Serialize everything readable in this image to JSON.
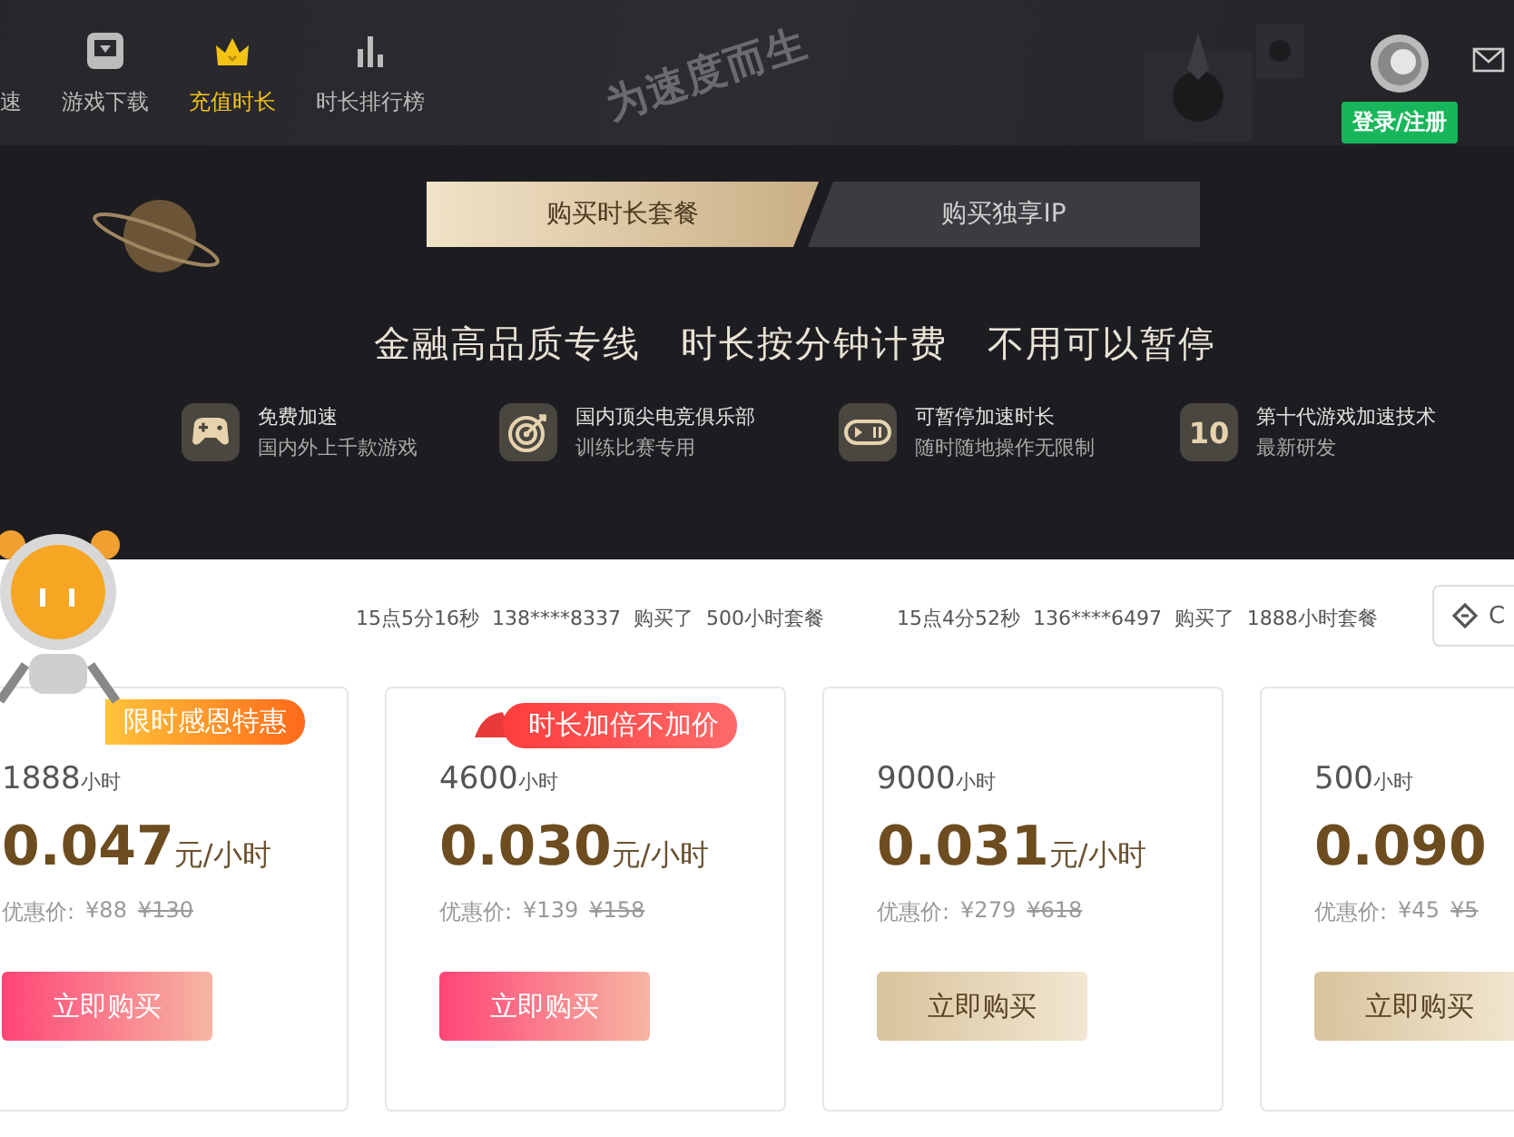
{
  "nav": {
    "items": [
      {
        "label": "速",
        "selected": false
      },
      {
        "label": "游戏下载",
        "kind": "download",
        "selected": false
      },
      {
        "label": "充值时长",
        "kind": "crown",
        "selected": true
      },
      {
        "label": "时长排行榜",
        "kind": "bars",
        "selected": false
      }
    ],
    "slogan": "为速度而生"
  },
  "user": {
    "login_button": "登录/注册"
  },
  "hero": {
    "tabs": [
      {
        "label": "购买时长套餐",
        "selected": true
      },
      {
        "label": "购买独享IP",
        "selected": false
      }
    ],
    "headline": "金融高品质专线   时长按分钟计费   不用可以暂停",
    "features": [
      {
        "kind": "gamepad",
        "title": "免费加速",
        "subtitle": "国内外上千款游戏"
      },
      {
        "kind": "target",
        "title": "国内顶尖电竞俱乐部",
        "subtitle": "训练比赛专用"
      },
      {
        "kind": "pause",
        "title": "可暂停加速时长",
        "subtitle": "随时随地操作无限制"
      },
      {
        "kind": "number",
        "icon_text": "10",
        "title": "第十代游戏加速技术",
        "subtitle": "最新研发"
      }
    ]
  },
  "ticker": [
    "15点5分16秒  138****8337  购买了  500小时套餐",
    "15点4分52秒  136****6497  购买了  1888小时套餐"
  ],
  "side_button": {
    "label": "C"
  },
  "plans": [
    {
      "hours": "1888",
      "hours_unit": "小时",
      "price": "0.047",
      "price_unit": "元/小时",
      "discount_label": "优惠价:",
      "discount_price": "¥88",
      "original_price": "¥130",
      "badge": {
        "kind": "sale",
        "text": "限时感恩特惠"
      },
      "button": {
        "kind": "promo",
        "label": "立即购买"
      }
    },
    {
      "hours": "4600",
      "hours_unit": "小时",
      "price": "0.030",
      "price_unit": "元/小时",
      "discount_label": "优惠价:",
      "discount_price": "¥139",
      "original_price": "¥158",
      "badge": {
        "kind": "holiday",
        "text": "时长加倍不加价"
      },
      "button": {
        "kind": "promo",
        "label": "立即购买"
      }
    },
    {
      "hours": "9000",
      "hours_unit": "小时",
      "price": "0.031",
      "price_unit": "元/小时",
      "discount_label": "优惠价:",
      "discount_price": "¥279",
      "original_price": "¥618",
      "button": {
        "kind": "standard",
        "label": "立即购买"
      }
    },
    {
      "hours": "500",
      "hours_unit": "小时",
      "price": "0.090",
      "discount_label": "优惠价:",
      "discount_price": "¥45",
      "original_price": "¥5",
      "button": {
        "kind": "standard",
        "label": "立即购买"
      }
    }
  ]
}
